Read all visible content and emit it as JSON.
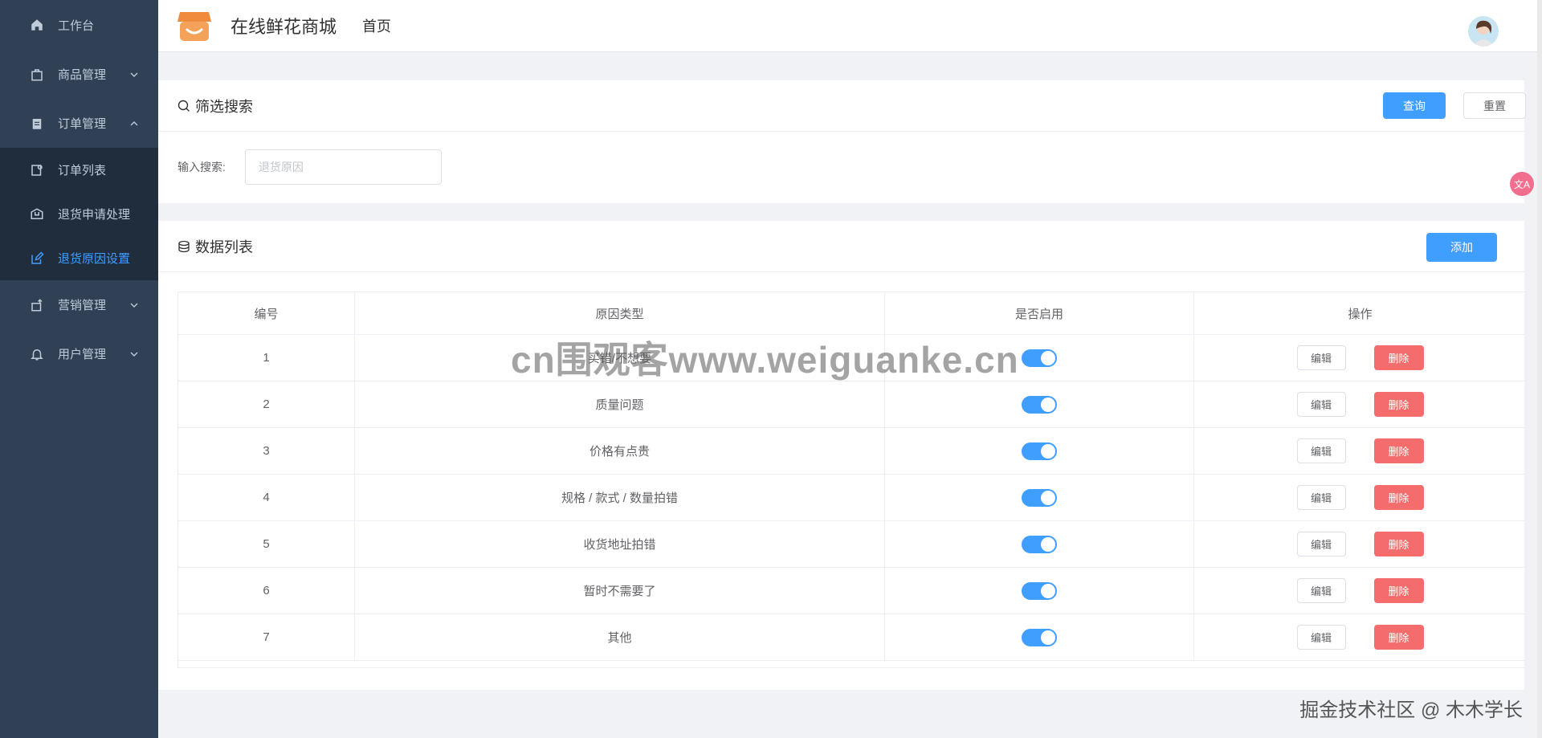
{
  "sidebar": {
    "items": [
      {
        "label": "工作台",
        "icon": "home-icon"
      },
      {
        "label": "商品管理",
        "icon": "bag-icon"
      },
      {
        "label": "订单管理",
        "icon": "clipboard-icon"
      },
      {
        "label": "营销管理",
        "icon": "marketing-icon"
      },
      {
        "label": "用户管理",
        "icon": "bell-icon"
      }
    ],
    "order_submenu": [
      {
        "label": "订单列表",
        "icon": "order-list-icon"
      },
      {
        "label": "退货申请处理",
        "icon": "box-icon"
      },
      {
        "label": "退货原因设置",
        "icon": "edit-icon",
        "active": true
      }
    ]
  },
  "header": {
    "title": "在线鲜花商城",
    "nav_home": "首页"
  },
  "search_panel": {
    "title": "筛选搜索",
    "query_label": "查询",
    "reset_label": "重置",
    "input_label": "输入搜索:",
    "input_placeholder": "退货原因",
    "input_value": ""
  },
  "list_panel": {
    "title": "数据列表",
    "add_label": "添加"
  },
  "table": {
    "headers": [
      "编号",
      "原因类型",
      "是否启用",
      "操作"
    ],
    "edit_label": "编辑",
    "delete_label": "删除",
    "rows": [
      {
        "id": "1",
        "reason": "买错/不想要",
        "enabled": true
      },
      {
        "id": "2",
        "reason": "质量问题",
        "enabled": true
      },
      {
        "id": "3",
        "reason": "价格有点贵",
        "enabled": true
      },
      {
        "id": "4",
        "reason": "规格 / 款式 / 数量拍错",
        "enabled": true
      },
      {
        "id": "5",
        "reason": "收货地址拍错",
        "enabled": true
      },
      {
        "id": "6",
        "reason": "暂时不需要了",
        "enabled": true
      },
      {
        "id": "7",
        "reason": "其他",
        "enabled": true
      }
    ]
  },
  "watermark_center": "cn围观客www.weiguanke.cn",
  "watermark_corner": "掘金技术社区 @ 木木学长",
  "colors": {
    "sidebar_bg": "#304156",
    "submenu_bg": "#1f2d3d",
    "primary": "#409eff",
    "danger": "#f56c6c"
  }
}
